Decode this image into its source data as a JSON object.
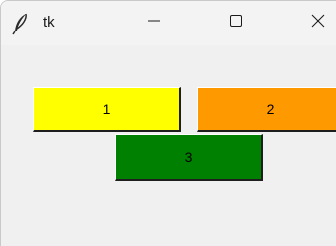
{
  "window": {
    "title": "tk",
    "icons": {
      "app": "feather-icon",
      "minimize": "minimize-icon",
      "maximize": "maximize-icon",
      "close": "close-icon"
    }
  },
  "buttons": [
    {
      "label": "1",
      "color": "#ffff00"
    },
    {
      "label": "2",
      "color": "#ff9900"
    },
    {
      "label": "3",
      "color": "#008000"
    }
  ]
}
